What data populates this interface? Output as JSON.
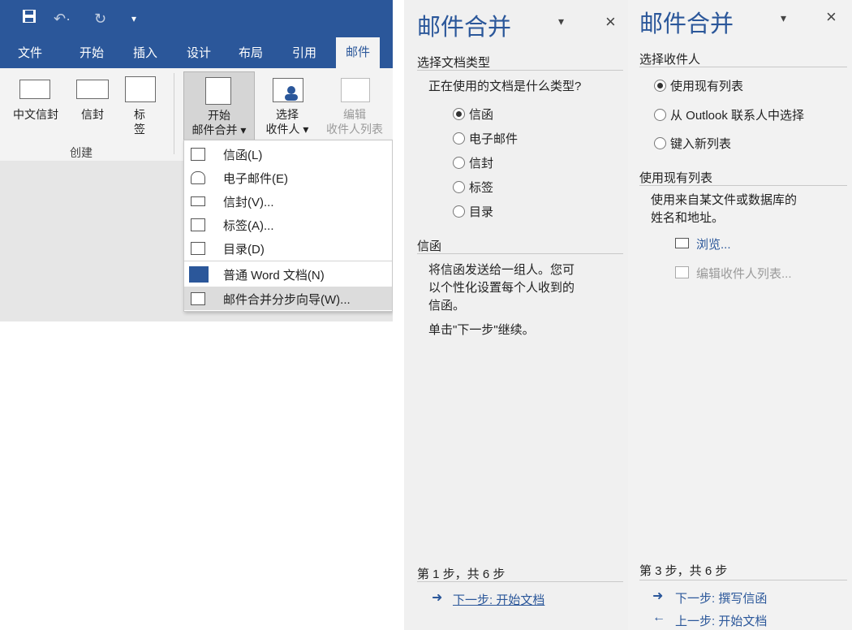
{
  "word": {
    "quick_access": {
      "save_icon": "save-icon",
      "undo_icon": "undo-icon",
      "redo_icon": "redo-icon",
      "customize_icon": "customize-qat-icon"
    },
    "tabs": [
      "文件",
      "开始",
      "插入",
      "设计",
      "布局",
      "引用",
      "邮件"
    ],
    "ribbon": {
      "create_buttons": [
        "中文信封",
        "信封",
        "标\n签"
      ],
      "group_create_label": "创建",
      "start_merge": [
        "开始",
        "邮件合并 ▾"
      ],
      "select_recipients": [
        "选择",
        "收件人 ▾"
      ],
      "edit_recipients": [
        "编辑",
        "收件人列表"
      ]
    },
    "dropdown": [
      {
        "label": "信函(L)",
        "icon": "letter-icon"
      },
      {
        "label": "电子邮件(E)",
        "icon": "email-icon"
      },
      {
        "label": "信封(V)...",
        "icon": "envelope-icon"
      },
      {
        "label": "标签(A)...",
        "icon": "labels-icon"
      },
      {
        "label": "目录(D)",
        "icon": "directory-icon"
      },
      {
        "label": "普通 Word 文档(N)",
        "icon": "word-doc-icon"
      },
      {
        "label": "邮件合并分步向导(W)...",
        "icon": "wizard-icon"
      }
    ],
    "accent": "#2b579a"
  },
  "pane1": {
    "title": "邮件合并",
    "section1": "选择文档类型",
    "question": "正在使用的文档是什么类型?",
    "options": [
      "信函",
      "电子邮件",
      "信封",
      "标签",
      "目录"
    ],
    "selected_index": 0,
    "section2": "信函",
    "desc": [
      "将信函发送给一组人。您可",
      "以个性化设置每个人收到的",
      "信函。"
    ],
    "continue": "单击\"下一步\"继续。",
    "step": "第 1 步，共 6 步",
    "next": "下一步: 开始文档"
  },
  "pane2": {
    "title": "邮件合并",
    "section1": "选择收件人",
    "options": [
      "使用现有列表",
      "从 Outlook 联系人中选择",
      "键入新列表"
    ],
    "selected_index": 0,
    "section2": "使用现有列表",
    "desc": [
      "使用来自某文件或数据库的",
      "姓名和地址。"
    ],
    "browse": "浏览...",
    "edit_list": "编辑收件人列表...",
    "step": "第 3 步，共 6 步",
    "next": "下一步: 撰写信函",
    "prev": "上一步: 开始文档"
  }
}
